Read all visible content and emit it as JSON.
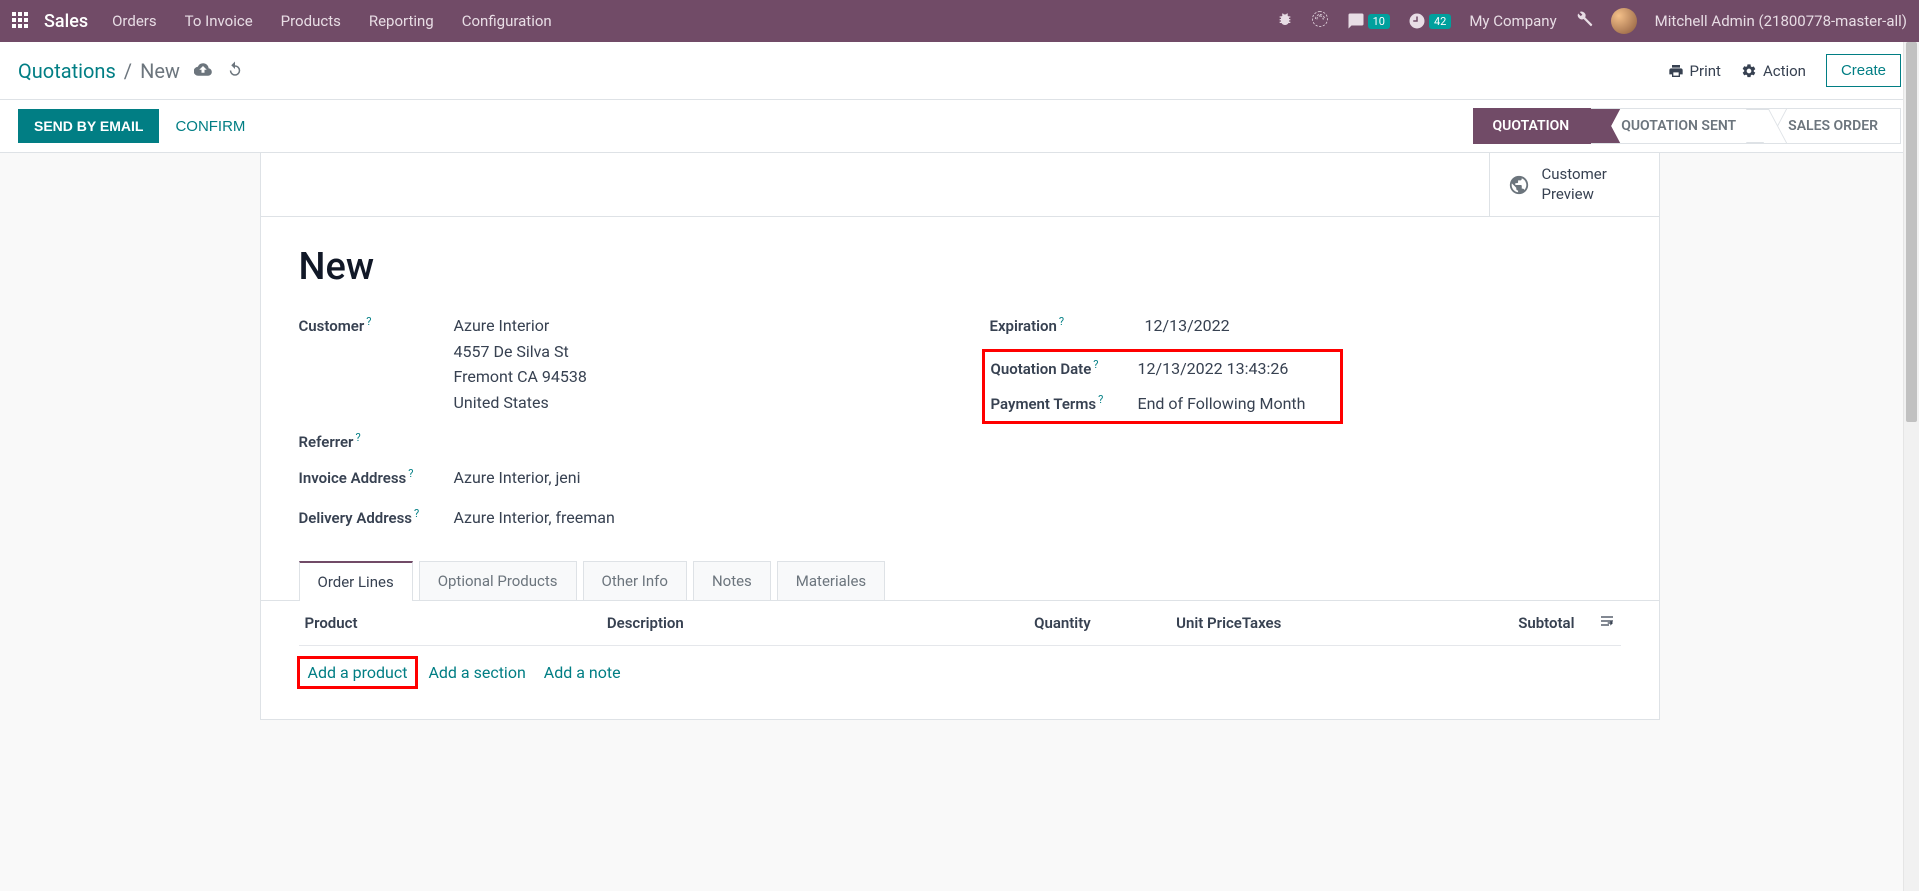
{
  "topnav": {
    "brand": "Sales",
    "links": [
      "Orders",
      "To Invoice",
      "Products",
      "Reporting",
      "Configuration"
    ],
    "messages_badge": "10",
    "activities_badge": "42",
    "company": "My Company",
    "user": "Mitchell Admin (21800778-master-all)"
  },
  "breadcrumb": {
    "root": "Quotations",
    "current": "New"
  },
  "control_buttons": {
    "print": "Print",
    "action": "Action",
    "create": "Create"
  },
  "statusbar": {
    "send_email": "SEND BY EMAIL",
    "confirm": "CONFIRM",
    "steps": [
      "QUOTATION",
      "QUOTATION SENT",
      "SALES ORDER"
    ]
  },
  "button_box": {
    "customer_preview": "Customer Preview"
  },
  "form": {
    "title": "New",
    "labels": {
      "customer": "Customer",
      "referrer": "Referrer",
      "invoice_address": "Invoice Address",
      "delivery_address": "Delivery Address",
      "expiration": "Expiration",
      "quotation_date": "Quotation Date",
      "payment_terms": "Payment Terms"
    },
    "values": {
      "customer_name": "Azure Interior",
      "customer_street": "4557 De Silva St",
      "customer_city": "Fremont CA 94538",
      "customer_country": "United States",
      "invoice_address": "Azure Interior, jeni",
      "delivery_address": "Azure Interior, freeman",
      "expiration": "12/13/2022",
      "quotation_date": "12/13/2022 13:43:26",
      "payment_terms": "End of Following Month"
    }
  },
  "tabs": [
    "Order Lines",
    "Optional Products",
    "Other Info",
    "Notes",
    "Materiales"
  ],
  "order_table": {
    "columns": [
      "Product",
      "Description",
      "Quantity",
      "Unit Price",
      "Taxes",
      "Subtotal"
    ],
    "add_product": "Add a product",
    "add_section": "Add a section",
    "add_note": "Add a note"
  }
}
